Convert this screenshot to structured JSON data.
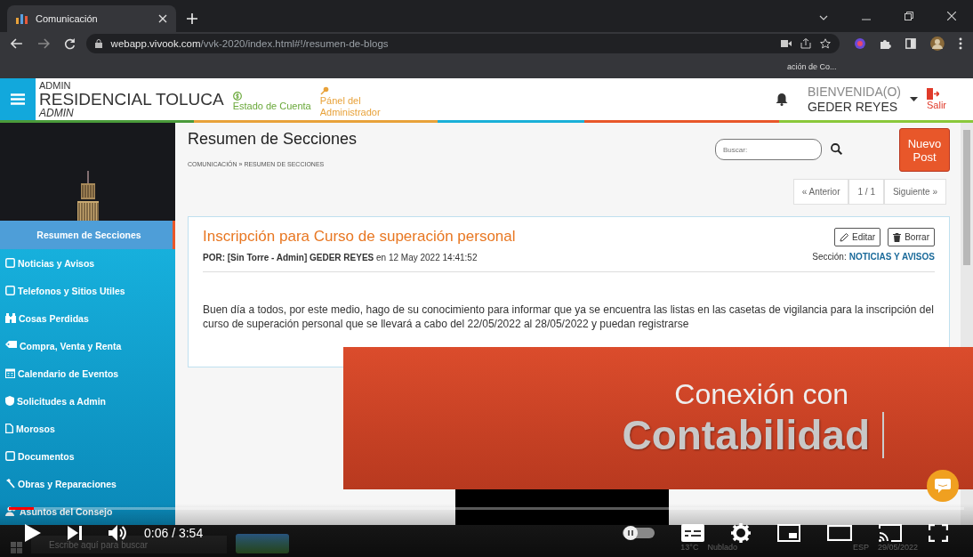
{
  "browser": {
    "tab_title": "Comunicación",
    "url_host": "webapp.vivook.com",
    "url_path": "/vvk-2020/index.html#!/resumen-de-blogs",
    "bookmark": "ación de Co..."
  },
  "header": {
    "role_top": "ADMIN",
    "site": "RESIDENCIAL TOLUCA",
    "role_bottom": "ADMIN",
    "links": [
      {
        "label": "Estado de Cuenta",
        "kind": "account"
      },
      {
        "label": "Pánel del Administrador",
        "kind": "admin"
      }
    ],
    "greeting": "BIENVENIDA(O)",
    "user": "GEDER REYES",
    "logout": "Salir"
  },
  "sidebar": {
    "items": [
      {
        "label": "Resumen de Secciones",
        "selected": true
      },
      {
        "label": "Noticias y Avisos",
        "selected": false
      },
      {
        "label": "Telefonos y Sitios Utiles",
        "selected": false
      },
      {
        "label": "Cosas Perdidas",
        "selected": false
      },
      {
        "label": "Compra, Venta y Renta",
        "selected": false
      },
      {
        "label": "Calendario de Eventos",
        "selected": false
      },
      {
        "label": "Solicitudes a Admin",
        "selected": false
      },
      {
        "label": "Morosos",
        "selected": false
      },
      {
        "label": "Documentos",
        "selected": false
      },
      {
        "label": "Obras y Reparaciones",
        "selected": false
      },
      {
        "label": "Asuntos del Consejo",
        "selected": false
      }
    ]
  },
  "page": {
    "title": "Resumen de Secciones",
    "breadcrumb": "COMUNICACIÓN » RESUMEN DE SECCIONES",
    "search": {
      "placeholder": "Buscar:"
    },
    "new_button": "Nuevo Post",
    "pagination": [
      "« Anterior",
      "1 / 1",
      "Siguiente »"
    ]
  },
  "post": {
    "title": "Inscripción para Curso de superación personal",
    "byline": "**POR: [Sin Torre - Admin] GEDER REYES** en 12 May 2022 14:41:52",
    "buttons": [
      {
        "label": "Editar",
        "kind": "edit"
      },
      {
        "label": "Borrar",
        "kind": "delete"
      }
    ],
    "section_label": "Sección:",
    "section": "NOTICIAS Y AVISOS",
    "body": "Buen día a todos, por este medio, hago de su conocimiento para informar que ya se encuentra las listas en las casetas de vigilancia para la inscripción del curso de superación personal que se llevará a cabo del 22/05/2022 al 28/05/2022 y puedan registrarse"
  },
  "overlay": {
    "line1": "Conexión con",
    "line2": "Contabilidad"
  },
  "player": {
    "time": "0:06 / 3:54",
    "level": 0.026
  },
  "taskbar": {
    "search_placeholder": "Escribe aquí para buscar",
    "temperature": "13°C",
    "weather": "Nublado",
    "language": "ESP",
    "date": "29/05/2022"
  }
}
